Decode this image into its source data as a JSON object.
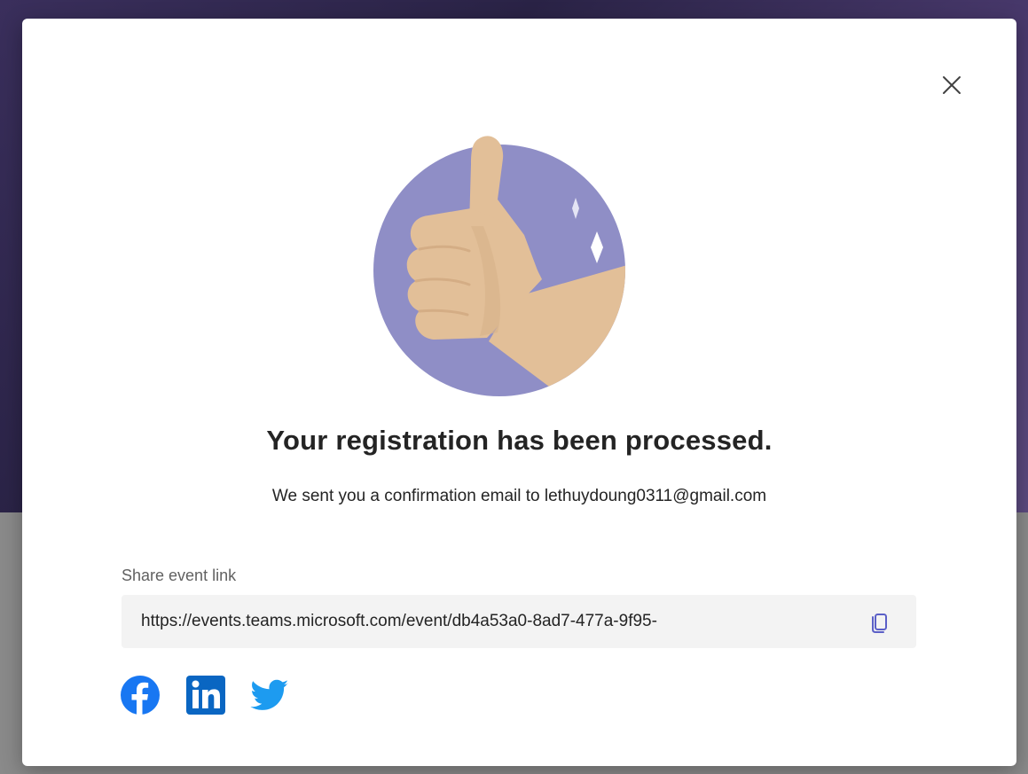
{
  "dialog": {
    "title": "Your registration has been processed.",
    "confirmation_text": "We sent you a confirmation email to lethuydoung0311@gmail.com",
    "share_label": "Share event link",
    "event_link": "https://events.teams.microsoft.com/event/db4a53a0-8ad7-477a-9f95-",
    "close_icon": "close-icon",
    "copy_icon": "copy-icon"
  },
  "illustration": {
    "icon": "thumbs-up-icon",
    "circle_color": "#8f8ec6",
    "hand_color": "#e2bf98"
  },
  "social": [
    {
      "icon": "facebook-icon",
      "color": "#1877f2"
    },
    {
      "icon": "linkedin-icon",
      "color": "#0a66c2"
    },
    {
      "icon": "twitter-icon",
      "color": "#1d9bf0"
    }
  ],
  "colors": {
    "accent": "#5b5fc7",
    "text_primary": "#242424",
    "text_secondary": "#616161",
    "link_box_bg": "#f3f3f3"
  }
}
